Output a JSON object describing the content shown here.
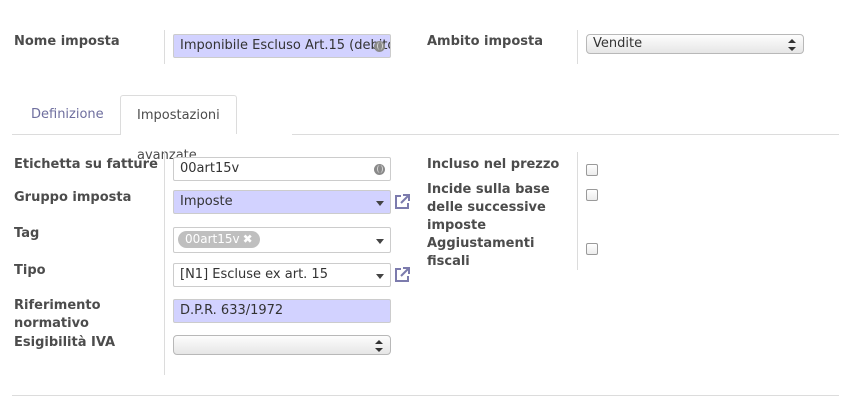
{
  "header": {
    "name_label": "Nome imposta",
    "name_value": "Imponibile Escluso Art.15 (debito",
    "scope_label": "Ambito imposta",
    "scope_value": "Vendite"
  },
  "tabs": [
    {
      "label": "Definizione",
      "active": false
    },
    {
      "label": "Impostazioni avanzate",
      "active": true
    }
  ],
  "left_fields": {
    "invoice_label": {
      "label": "Etichetta su fatture",
      "value": "00art15v"
    },
    "tax_group": {
      "label": "Gruppo imposta",
      "value": "Imposte"
    },
    "tag": {
      "label": "Tag",
      "chip": "00art15v",
      "remove_icon": "✖"
    },
    "type": {
      "label": "Tipo",
      "value": "[N1] Escluse ex art. 15"
    },
    "legal_ref": {
      "label_line1": "Riferimento",
      "label_line2": "normativo",
      "value": "D.P.R. 633/1972"
    },
    "vat_due": {
      "label": "Esigibilità IVA",
      "value": ""
    }
  },
  "right_fields": {
    "included_in_price": {
      "label": "Incluso nel prezzo",
      "checked": false
    },
    "affects_base": {
      "label_line1": "Incide sulla base",
      "label_line2": "delle successive",
      "label_line3": "imposte",
      "checked": false
    },
    "fiscal_adjustments": {
      "label_line1": "Aggiustamenti",
      "label_line2": "fiscali",
      "checked": false
    }
  },
  "icons": {
    "external_link": "external-link-icon",
    "translate": "globe-icon",
    "dropdown": "caret-down-icon"
  },
  "colors": {
    "required_field_bg": "#d2d2ff",
    "external_link": "#7c7bad",
    "inactive_tab": "#6e6e9e",
    "label": "#4c4c4c"
  }
}
